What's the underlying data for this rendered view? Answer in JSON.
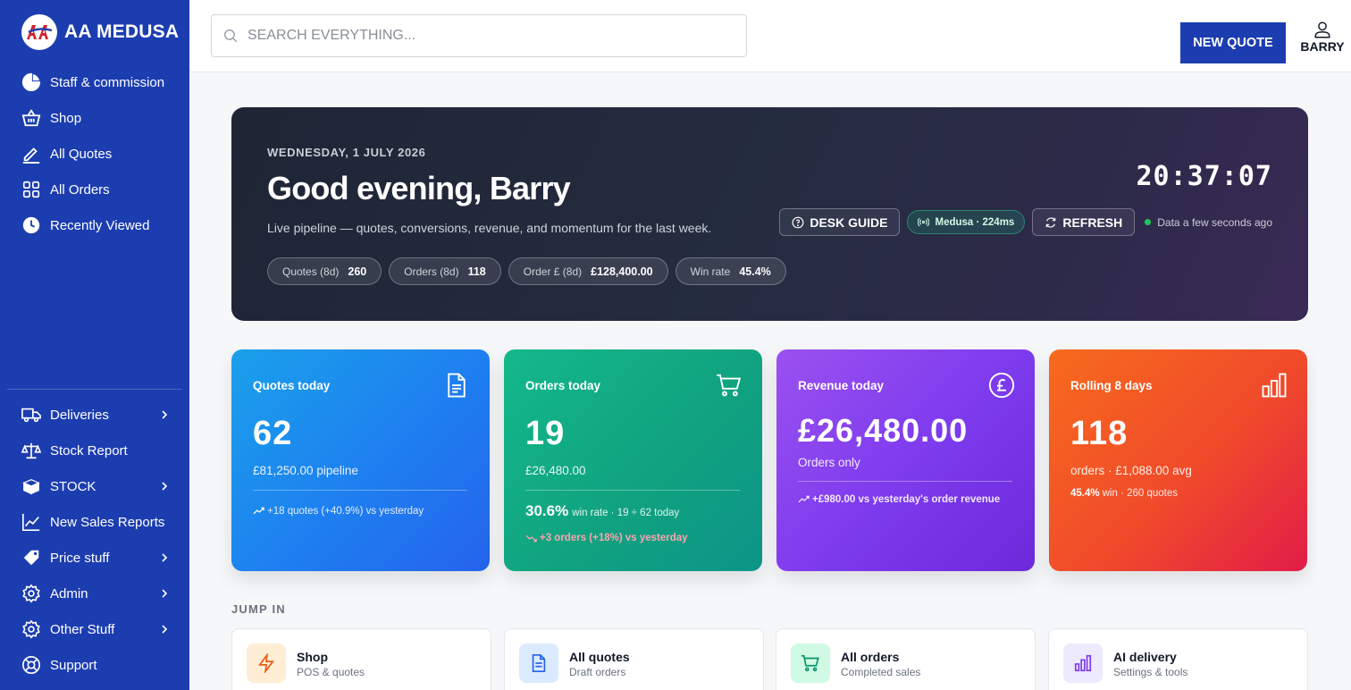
{
  "brand": {
    "logo_text": "AA",
    "name": "AA MEDUSA"
  },
  "sidebar": {
    "top_items": [
      {
        "label": "Staff & commission",
        "icon": "pie-chart-icon"
      },
      {
        "label": "Shop",
        "icon": "basket-icon"
      },
      {
        "label": "All Quotes",
        "icon": "pen-icon"
      },
      {
        "label": "All Orders",
        "icon": "grid-icon"
      },
      {
        "label": "Recently Viewed",
        "icon": "clock-icon"
      }
    ],
    "bottom_items": [
      {
        "label": "Deliveries",
        "icon": "truck-icon",
        "has_submenu": true
      },
      {
        "label": "Stock Report",
        "icon": "scale-icon",
        "has_submenu": false
      },
      {
        "label": "STOCK",
        "icon": "box-icon",
        "has_submenu": true
      },
      {
        "label": "New Sales Reports",
        "icon": "line-chart-icon",
        "has_submenu": false
      },
      {
        "label": "Price stuff",
        "icon": "tag-icon",
        "has_submenu": true
      },
      {
        "label": "Admin",
        "icon": "gear-icon",
        "has_submenu": true
      },
      {
        "label": "Other Stuff",
        "icon": "gear-icon",
        "has_submenu": true
      },
      {
        "label": "Support",
        "icon": "lifebuoy-icon",
        "has_submenu": false
      }
    ]
  },
  "header": {
    "search_placeholder": "SEARCH EVERYTHING...",
    "new_quote_label": "NEW QUOTE",
    "user_name": "BARRY"
  },
  "hero": {
    "date": "WEDNESDAY, 1 JULY 2026",
    "greeting": "Good evening, Barry",
    "subtitle": "Live pipeline — quotes, conversions, revenue, and momentum for the last week.",
    "clock": "20:37:07",
    "desk_guide_label": "DESK GUIDE",
    "latency_label": "Medusa · 224ms",
    "refresh_label": "REFRESH",
    "freshness": "Data a few seconds ago",
    "pills": [
      {
        "label": "Quotes (8d)",
        "value": "260"
      },
      {
        "label": "Orders (8d)",
        "value": "118"
      },
      {
        "label": "Order £ (8d)",
        "value": "£128,400.00"
      },
      {
        "label": "Win rate",
        "value": "45.4%"
      }
    ]
  },
  "kpis": {
    "quotes": {
      "title": "Quotes today",
      "value": "62",
      "sub": "£81,250.00 pipeline",
      "trend": "+18 quotes (+40.9%) vs yesterday"
    },
    "orders": {
      "title": "Orders today",
      "value": "19",
      "sub": "£26,480.00",
      "win_rate": "30.6%",
      "win_rate_text": "win rate · 19 ÷ 62 today",
      "trend": "+3 orders (+18%) vs yesterday"
    },
    "revenue": {
      "title": "Revenue today",
      "value": "£26,480.00",
      "sub": "Orders only",
      "trend": "+£980.00 vs yesterday's order revenue"
    },
    "rolling": {
      "title": "Rolling 8 days",
      "value": "118",
      "sub": "orders · £1,088.00 avg",
      "win_pct": "45.4%",
      "win_text": "win · 260 quotes"
    }
  },
  "jump_in": {
    "title": "JUMP IN",
    "cards": [
      {
        "title": "Shop",
        "sub": "POS & quotes",
        "icon": "lightning-icon"
      },
      {
        "title": "All quotes",
        "sub": "Draft orders",
        "icon": "document-icon"
      },
      {
        "title": "All orders",
        "sub": "Completed sales",
        "icon": "cart-icon"
      },
      {
        "title": "AI delivery",
        "sub": "Settings & tools",
        "icon": "bar-chart-icon"
      }
    ]
  },
  "colors": {
    "sidebar": "#1c3db0",
    "quotes_card": "#2563eb",
    "orders_card": "#10a37f",
    "revenue_card": "#7c3aed",
    "rolling_card": "#ef4444",
    "status_online": "#22c55e"
  }
}
